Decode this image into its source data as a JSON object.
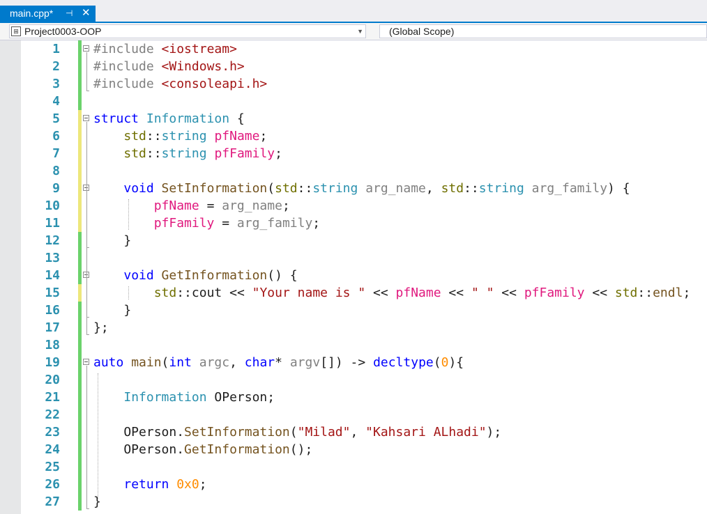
{
  "tab": {
    "title": "main.cpp*",
    "pin_glyph": "⊣",
    "close_glyph": "✕",
    "accent": "#007acc"
  },
  "navbar": {
    "project": "Project0003-OOP",
    "scope": "(Global Scope)",
    "project_icon": "project-icon"
  },
  "colors": {
    "keyword": "#0000ff",
    "type": "#2b91af",
    "string": "#a31515",
    "preproc": "#808080",
    "field": "#e0197e",
    "param": "#808080",
    "func": "#74531f",
    "namespace": "#6f6f00",
    "number": "#ff8c00",
    "linenumber": "#2b91af",
    "change_saved": "#6bd26b",
    "change_unsaved": "#ede77b"
  },
  "lines": [
    {
      "n": "1",
      "change": "saved",
      "fold": true,
      "tokens": [
        [
          "#include ",
          "preproc"
        ],
        [
          "<iostream>",
          "string"
        ]
      ]
    },
    {
      "n": "2",
      "change": "saved",
      "tokens": [
        [
          "#include ",
          "preproc"
        ],
        [
          "<Windows.h>",
          "string"
        ]
      ]
    },
    {
      "n": "3",
      "change": "saved",
      "tokens": [
        [
          "#include ",
          "preproc"
        ],
        [
          "<consoleapi.h>",
          "string"
        ]
      ]
    },
    {
      "n": "4",
      "change": "saved",
      "tokens": []
    },
    {
      "n": "5",
      "change": "unsaved",
      "fold": true,
      "tokens": [
        [
          "struct ",
          "keyword"
        ],
        [
          "Information",
          "type"
        ],
        [
          " {",
          "plain"
        ]
      ]
    },
    {
      "n": "6",
      "change": "unsaved",
      "tokens": [
        [
          "    ",
          "plain"
        ],
        [
          "std",
          "namespace"
        ],
        [
          "::",
          "plain"
        ],
        [
          "string",
          "type"
        ],
        [
          " ",
          "plain"
        ],
        [
          "pfName",
          "field"
        ],
        [
          ";",
          "plain"
        ]
      ]
    },
    {
      "n": "7",
      "change": "unsaved",
      "tokens": [
        [
          "    ",
          "plain"
        ],
        [
          "std",
          "namespace"
        ],
        [
          "::",
          "plain"
        ],
        [
          "string",
          "type"
        ],
        [
          " ",
          "plain"
        ],
        [
          "pfFamily",
          "field"
        ],
        [
          ";",
          "plain"
        ]
      ]
    },
    {
      "n": "8",
      "change": "unsaved",
      "tokens": []
    },
    {
      "n": "9",
      "change": "unsaved",
      "fold": true,
      "tokens": [
        [
          "    ",
          "plain"
        ],
        [
          "void ",
          "keyword"
        ],
        [
          "SetInformation",
          "func"
        ],
        [
          "(",
          "plain"
        ],
        [
          "std",
          "namespace"
        ],
        [
          "::",
          "plain"
        ],
        [
          "string",
          "type"
        ],
        [
          " ",
          "plain"
        ],
        [
          "arg_name",
          "param"
        ],
        [
          ", ",
          "plain"
        ],
        [
          "std",
          "namespace"
        ],
        [
          "::",
          "plain"
        ],
        [
          "string",
          "type"
        ],
        [
          " ",
          "plain"
        ],
        [
          "arg_family",
          "param"
        ],
        [
          ") {",
          "plain"
        ]
      ]
    },
    {
      "n": "10",
      "change": "unsaved",
      "tokens": [
        [
          "        ",
          "plain"
        ],
        [
          "pfName",
          "field"
        ],
        [
          " = ",
          "plain"
        ],
        [
          "arg_name",
          "param"
        ],
        [
          ";",
          "plain"
        ]
      ]
    },
    {
      "n": "11",
      "change": "unsaved",
      "tokens": [
        [
          "        ",
          "plain"
        ],
        [
          "pfFamily",
          "field"
        ],
        [
          " = ",
          "plain"
        ],
        [
          "arg_family",
          "param"
        ],
        [
          ";",
          "plain"
        ]
      ]
    },
    {
      "n": "12",
      "change": "saved",
      "tokens": [
        [
          "    }",
          "plain"
        ]
      ]
    },
    {
      "n": "13",
      "change": "saved",
      "tokens": []
    },
    {
      "n": "14",
      "change": "saved",
      "fold": true,
      "tokens": [
        [
          "    ",
          "plain"
        ],
        [
          "void ",
          "keyword"
        ],
        [
          "GetInformation",
          "func"
        ],
        [
          "() {",
          "plain"
        ]
      ]
    },
    {
      "n": "15",
      "change": "unsaved",
      "tokens": [
        [
          "        ",
          "plain"
        ],
        [
          "std",
          "namespace"
        ],
        [
          "::",
          "plain"
        ],
        [
          "cout",
          "plain"
        ],
        [
          " << ",
          "plain"
        ],
        [
          "\"Your name is \"",
          "string"
        ],
        [
          " << ",
          "plain"
        ],
        [
          "pfName",
          "field"
        ],
        [
          " << ",
          "plain"
        ],
        [
          "\" \"",
          "string"
        ],
        [
          " << ",
          "plain"
        ],
        [
          "pfFamily",
          "field"
        ],
        [
          " << ",
          "plain"
        ],
        [
          "std",
          "namespace"
        ],
        [
          "::",
          "plain"
        ],
        [
          "endl",
          "func"
        ],
        [
          ";",
          "plain"
        ]
      ]
    },
    {
      "n": "16",
      "change": "saved",
      "tokens": [
        [
          "    }",
          "plain"
        ]
      ]
    },
    {
      "n": "17",
      "change": "saved",
      "tokens": [
        [
          "};",
          "plain"
        ]
      ]
    },
    {
      "n": "18",
      "change": "saved",
      "tokens": []
    },
    {
      "n": "19",
      "change": "saved",
      "fold": true,
      "tokens": [
        [
          "auto ",
          "keyword"
        ],
        [
          "main",
          "func"
        ],
        [
          "(",
          "plain"
        ],
        [
          "int ",
          "keyword"
        ],
        [
          "argc",
          "param"
        ],
        [
          ", ",
          "plain"
        ],
        [
          "char",
          "keyword"
        ],
        [
          "* ",
          "plain"
        ],
        [
          "argv",
          "param"
        ],
        [
          "[]) -> ",
          "plain"
        ],
        [
          "decltype",
          "keyword"
        ],
        [
          "(",
          "plain"
        ],
        [
          "0",
          "number"
        ],
        [
          "){",
          "plain"
        ]
      ]
    },
    {
      "n": "20",
      "change": "saved",
      "tokens": []
    },
    {
      "n": "21",
      "change": "saved",
      "tokens": [
        [
          "    ",
          "plain"
        ],
        [
          "Information",
          "type"
        ],
        [
          " OPerson;",
          "plain"
        ]
      ]
    },
    {
      "n": "22",
      "change": "saved",
      "tokens": []
    },
    {
      "n": "23",
      "change": "saved",
      "tokens": [
        [
          "    OPerson.",
          "plain"
        ],
        [
          "SetInformation",
          "func"
        ],
        [
          "(",
          "plain"
        ],
        [
          "\"Milad\"",
          "string"
        ],
        [
          ", ",
          "plain"
        ],
        [
          "\"Kahsari ALhadi\"",
          "string"
        ],
        [
          ");",
          "plain"
        ]
      ]
    },
    {
      "n": "24",
      "change": "saved",
      "tokens": [
        [
          "    OPerson.",
          "plain"
        ],
        [
          "GetInformation",
          "func"
        ],
        [
          "();",
          "plain"
        ]
      ]
    },
    {
      "n": "25",
      "change": "saved",
      "tokens": []
    },
    {
      "n": "26",
      "change": "saved",
      "tokens": [
        [
          "    ",
          "plain"
        ],
        [
          "return ",
          "keyword"
        ],
        [
          "0x0",
          "number"
        ],
        [
          ";",
          "plain"
        ]
      ]
    },
    {
      "n": "27",
      "change": "saved",
      "tokens": [
        [
          "}",
          "plain"
        ]
      ]
    }
  ]
}
